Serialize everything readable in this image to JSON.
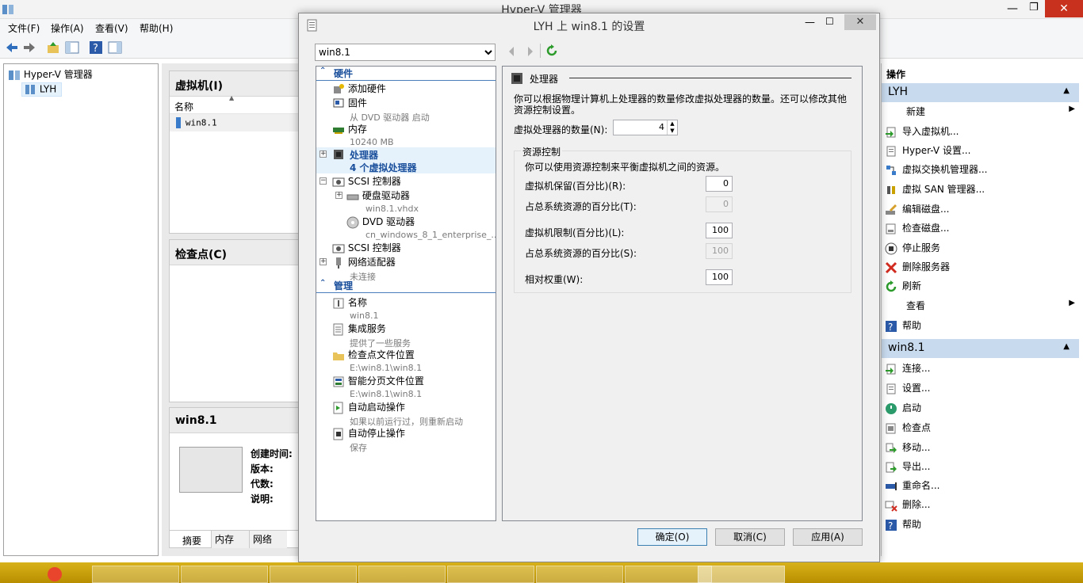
{
  "main_window": {
    "title": "Hyper-V 管理器",
    "menu": [
      "文件(F)",
      "操作(A)",
      "查看(V)",
      "帮助(H)"
    ]
  },
  "tree": {
    "root": "Hyper-V 管理器",
    "child": "LYH"
  },
  "vm_list": {
    "header": "虚拟机(I)",
    "col_name": "名称",
    "row": "win8.1"
  },
  "checkpoints": {
    "header": "检查点(C)"
  },
  "details": {
    "header": "win8.1",
    "labels": [
      "创建时间:",
      "版本:",
      "代数:",
      "说明:"
    ],
    "tabs": [
      "摘要",
      "内存",
      "网络"
    ]
  },
  "actions": {
    "title": "操作",
    "group1": {
      "header": "LYH",
      "items": [
        "新建",
        "导入虚拟机...",
        "Hyper-V 设置...",
        "虚拟交换机管理器...",
        "虚拟 SAN 管理器...",
        "编辑磁盘...",
        "检查磁盘...",
        "停止服务",
        "删除服务器",
        "刷新",
        "查看",
        "帮助"
      ]
    },
    "group2": {
      "header": "win8.1",
      "items": [
        "连接...",
        "设置...",
        "启动",
        "检查点",
        "移动...",
        "导出...",
        "重命名...",
        "删除...",
        "帮助"
      ]
    }
  },
  "dialog": {
    "title": "LYH 上 win8.1 的设置",
    "vm_select": "win8.1",
    "hardware_header": "硬件",
    "management_header": "管理",
    "hardware": [
      {
        "label": "添加硬件",
        "sub": ""
      },
      {
        "label": "固件",
        "sub": "从 DVD 驱动器 启动"
      },
      {
        "label": "内存",
        "sub": "10240 MB"
      },
      {
        "label": "处理器",
        "sub": "4 个虚拟处理器"
      },
      {
        "label": "SCSI 控制器",
        "sub": ""
      },
      {
        "label": "硬盘驱动器",
        "sub": "win8.1.vhdx"
      },
      {
        "label": "DVD 驱动器",
        "sub": "cn_windows_8_1_enterprise_..."
      },
      {
        "label": "SCSI 控制器",
        "sub": ""
      },
      {
        "label": "网络适配器",
        "sub": "未连接"
      }
    ],
    "management": [
      {
        "label": "名称",
        "sub": "win8.1"
      },
      {
        "label": "集成服务",
        "sub": "提供了一些服务"
      },
      {
        "label": "检查点文件位置",
        "sub": "E:\\win8.1\\win8.1"
      },
      {
        "label": "智能分页文件位置",
        "sub": "E:\\win8.1\\win8.1"
      },
      {
        "label": "自动启动操作",
        "sub": "如果以前运行过，则重新启动"
      },
      {
        "label": "自动停止操作",
        "sub": "保存"
      }
    ],
    "panel": {
      "title": "处理器",
      "desc": "你可以根据物理计算机上处理器的数量修改虚拟处理器的数量。还可以修改其他资源控制设置。",
      "count_label": "虚拟处理器的数量(N):",
      "count_value": "4",
      "rc_title": "资源控制",
      "rc_desc": "你可以使用资源控制来平衡虚拟机之间的资源。",
      "reserve_label": "虚拟机保留(百分比)(R):",
      "reserve_value": "0",
      "reserve_pct_label": "占总系统资源的百分比(T):",
      "reserve_pct_value": "0",
      "limit_label": "虚拟机限制(百分比)(L):",
      "limit_value": "100",
      "limit_pct_label": "占总系统资源的百分比(S):",
      "limit_pct_value": "100",
      "weight_label": "相对权重(W):",
      "weight_value": "100"
    },
    "buttons": {
      "ok": "确定(O)",
      "cancel": "取消(C)",
      "apply": "应用(A)"
    }
  }
}
